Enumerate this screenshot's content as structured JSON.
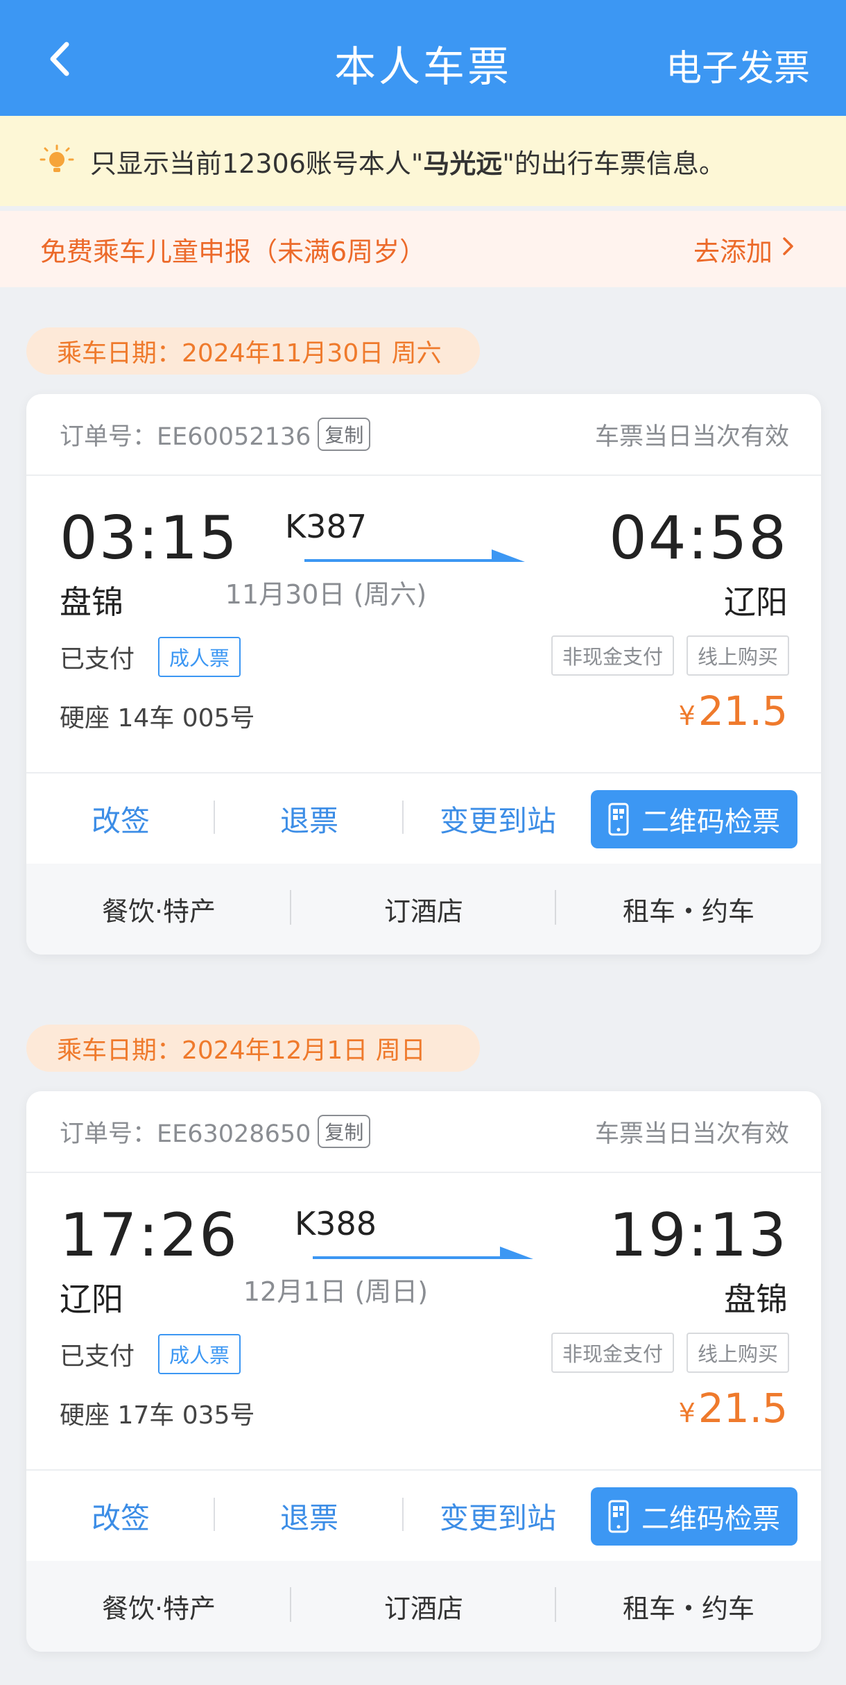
{
  "header": {
    "title": "本人车票",
    "invoice_label": "电子发票"
  },
  "notice": {
    "prefix": "只显示当前12306账号本人\"",
    "name": "马光远",
    "suffix": "\"的出行车票信息。"
  },
  "child_declare": {
    "label": "免费乘车儿童申报（未满6周岁）",
    "action": "去添加"
  },
  "colors": {
    "primary": "#3c97f3",
    "accent_orange": "#ef7a2c",
    "notice_bg": "#fdf7d6"
  },
  "trips": [
    {
      "date_label": "乘车日期：2024年11月30日 周六",
      "order_no": "订单号：EE60052136",
      "copy_label": "复制",
      "validity": "车票当日当次有效",
      "dep_time": "03:15",
      "dep_station": "盘锦",
      "train_no": "K387",
      "run_date": "11月30日 (周六)",
      "arr_time": "04:58",
      "arr_station": "辽阳",
      "status": "已支付",
      "ticket_type": "成人票",
      "pay_method": "非现金支付",
      "purchase_channel": "线上购买",
      "seat": "硬座 14车 005号",
      "currency": "¥",
      "price": "21.5",
      "actions": [
        "改签",
        "退票",
        "变更到站"
      ],
      "qr_label": "二维码检票",
      "services": [
        "餐饮·特产",
        "订酒店",
        "租车・约车"
      ]
    },
    {
      "date_label": "乘车日期：2024年12月1日 周日",
      "order_no": "订单号：EE63028650",
      "copy_label": "复制",
      "validity": "车票当日当次有效",
      "dep_time": "17:26",
      "dep_station": "辽阳",
      "train_no": "K388",
      "run_date": "12月1日 (周日)",
      "arr_time": "19:13",
      "arr_station": "盘锦",
      "status": "已支付",
      "ticket_type": "成人票",
      "pay_method": "非现金支付",
      "purchase_channel": "线上购买",
      "seat": "硬座 17车 035号",
      "currency": "¥",
      "price": "21.5",
      "actions": [
        "改签",
        "退票",
        "变更到站"
      ],
      "qr_label": "二维码检票",
      "services": [
        "餐饮·特产",
        "订酒店",
        "租车・约车"
      ]
    }
  ]
}
